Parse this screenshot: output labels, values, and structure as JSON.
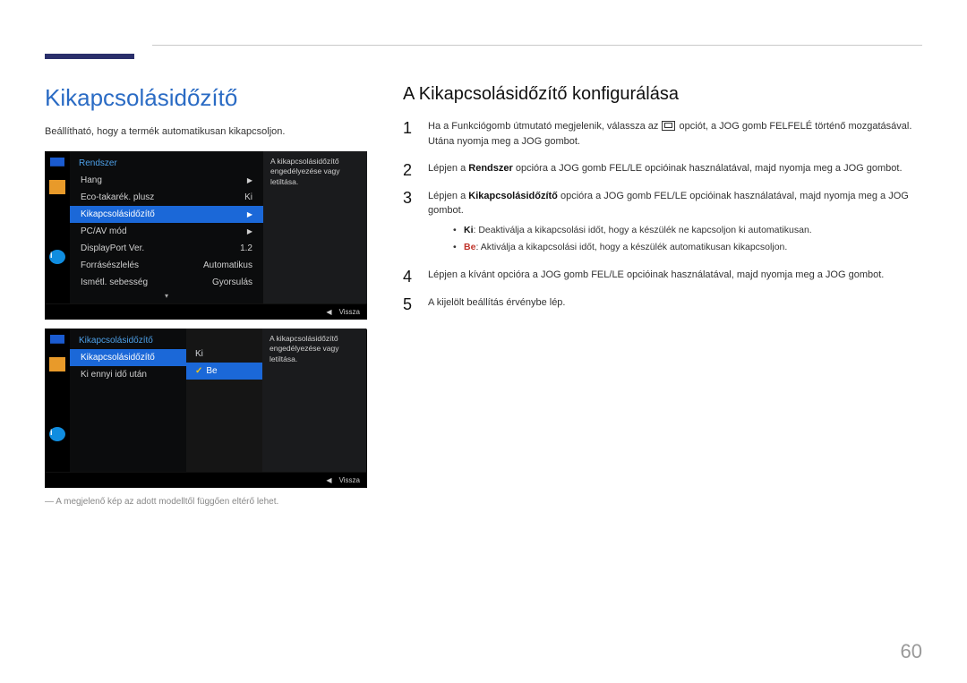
{
  "header": {
    "section_title": "Kikapcsolásidőzítő",
    "subhead": "A Kikapcsolásidőzítő konfigurálása"
  },
  "left": {
    "desc": "Beállítható, hogy a termék automatikusan kikapcsoljon.",
    "note": "― A megjelenő kép az adott modelltől függően eltérő lehet."
  },
  "menu1": {
    "title": "Rendszer",
    "items": [
      {
        "label": "Hang",
        "value": "",
        "arrow": "▶"
      },
      {
        "label": "Eco-takarék. plusz",
        "value": "Ki",
        "arrow": ""
      },
      {
        "label": "Kikapcsolásidőzítő",
        "value": "",
        "arrow": "▶",
        "selected": true
      },
      {
        "label": "PC/AV mód",
        "value": "",
        "arrow": "▶"
      },
      {
        "label": "DisplayPort Ver.",
        "value": "1.2",
        "arrow": ""
      },
      {
        "label": "Forrásészlelés",
        "value": "Automatikus",
        "arrow": ""
      },
      {
        "label": "Ismétl. sebesség",
        "value": "Gyorsulás",
        "arrow": ""
      }
    ],
    "side": "A kikapcsolásidőzítő engedélyezése vagy letiltása.",
    "back": "Vissza"
  },
  "menu2": {
    "title": "Kikapcsolásidőzítő",
    "items": [
      {
        "label": "Kikapcsolásidőzítő",
        "value": "Ki",
        "selected": true
      },
      {
        "label": "Ki ennyi idő után",
        "value": ""
      }
    ],
    "options": [
      {
        "label": "",
        "value": ""
      },
      {
        "label": "Be",
        "selected": true
      }
    ],
    "side": "A kikapcsolásidőzítő engedélyezése vagy letiltása.",
    "back": "Vissza"
  },
  "steps": {
    "s1a": "Ha a Funkciógomb útmutató megjelenik, válassza az ",
    "s1b": " opciót, a JOG gomb FELFELÉ történő mozgatásával. Utána nyomja meg a JOG gombot.",
    "s2a": "Lépjen a ",
    "s2_strong": "Rendszer",
    "s2b": " opcióra a JOG gomb FEL/LE opcióinak használatával, majd nyomja meg a JOG gombot.",
    "s3a": "Lépjen a ",
    "s3_strong": "Kikapcsolásidőzítő",
    "s3b": " opcióra a JOG gomb FEL/LE opcióinak használatával, majd nyomja meg a JOG gombot.",
    "b_ki_label": "Ki",
    "b_ki": ": Deaktiválja a kikapcsolási időt, hogy a készülék ne kapcsoljon ki automatikusan.",
    "b_be_label": "Be",
    "b_be": ": Aktiválja a kikapcsolási időt, hogy a készülék automatikusan kikapcsoljon.",
    "s4": "Lépjen a kívánt opcióra a JOG gomb FEL/LE opcióinak használatával, majd nyomja meg a JOG gombot.",
    "s5": "A kijelölt beállítás érvénybe lép."
  },
  "page_number": "60"
}
